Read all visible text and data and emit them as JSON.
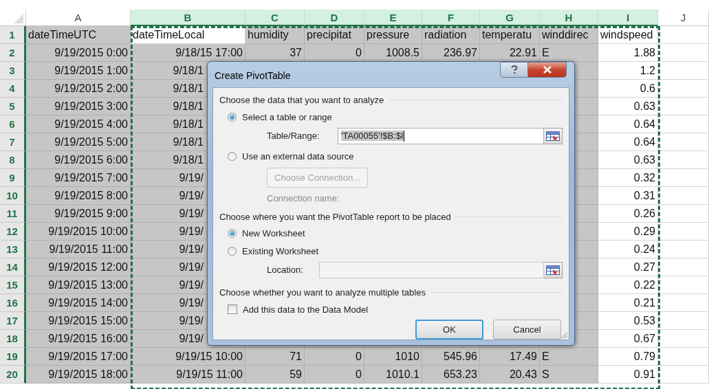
{
  "sheet": {
    "columns": [
      {
        "label": "A",
        "selected": false
      },
      {
        "label": "B",
        "selected": true
      },
      {
        "label": "C",
        "selected": true
      },
      {
        "label": "D",
        "selected": true
      },
      {
        "label": "E",
        "selected": true
      },
      {
        "label": "F",
        "selected": true
      },
      {
        "label": "G",
        "selected": true
      },
      {
        "label": "H",
        "selected": true
      },
      {
        "label": "I",
        "selected": true
      },
      {
        "label": "J",
        "selected": false
      }
    ],
    "rows": [
      {
        "label": "1",
        "cells": [
          "dateTimeUTC",
          "dateTimeLocal",
          "humidity",
          "precipitat",
          "pressure",
          "radiation",
          "temperatu",
          "winddirec",
          "windspeed"
        ]
      },
      {
        "label": "2",
        "cells": [
          "9/19/2015 0:00",
          "9/18/15 17:00",
          "37",
          "0",
          "1008.5",
          "236.97",
          "22.91",
          "E",
          "1.88"
        ]
      },
      {
        "label": "3",
        "cells": [
          "9/19/2015 1:00",
          "9/18/1",
          null,
          null,
          null,
          null,
          null,
          null,
          "1.2"
        ]
      },
      {
        "label": "4",
        "cells": [
          "9/19/2015 2:00",
          "9/18/1",
          null,
          null,
          null,
          null,
          null,
          null,
          "0.6"
        ]
      },
      {
        "label": "5",
        "cells": [
          "9/19/2015 3:00",
          "9/18/1",
          null,
          null,
          null,
          null,
          null,
          null,
          "0.63"
        ]
      },
      {
        "label": "6",
        "cells": [
          "9/19/2015 4:00",
          "9/18/1",
          null,
          null,
          null,
          null,
          null,
          null,
          "0.64"
        ]
      },
      {
        "label": "7",
        "cells": [
          "9/19/2015 5:00",
          "9/18/1",
          null,
          null,
          null,
          null,
          null,
          null,
          "0.64"
        ]
      },
      {
        "label": "8",
        "cells": [
          "9/19/2015 6:00",
          "9/18/1",
          null,
          null,
          null,
          null,
          null,
          null,
          "0.63"
        ]
      },
      {
        "label": "9",
        "cells": [
          "9/19/2015 7:00",
          "9/19/",
          null,
          null,
          null,
          null,
          null,
          null,
          "0.32"
        ]
      },
      {
        "label": "10",
        "cells": [
          "9/19/2015 8:00",
          "9/19/",
          null,
          null,
          null,
          null,
          null,
          null,
          "0.31"
        ]
      },
      {
        "label": "11",
        "cells": [
          "9/19/2015 9:00",
          "9/19/",
          null,
          null,
          null,
          null,
          null,
          null,
          "0.26"
        ]
      },
      {
        "label": "12",
        "cells": [
          "9/19/2015 10:00",
          "9/19/",
          null,
          null,
          null,
          null,
          null,
          null,
          "0.29"
        ]
      },
      {
        "label": "13",
        "cells": [
          "9/19/2015 11:00",
          "9/19/",
          null,
          null,
          null,
          null,
          null,
          null,
          "0.24"
        ]
      },
      {
        "label": "14",
        "cells": [
          "9/19/2015 12:00",
          "9/19/",
          null,
          null,
          null,
          null,
          null,
          null,
          "0.27"
        ]
      },
      {
        "label": "15",
        "cells": [
          "9/19/2015 13:00",
          "9/19/",
          null,
          null,
          null,
          null,
          null,
          null,
          "0.22"
        ]
      },
      {
        "label": "16",
        "cells": [
          "9/19/2015 14:00",
          "9/19/",
          null,
          null,
          null,
          null,
          null,
          null,
          "0.21"
        ]
      },
      {
        "label": "17",
        "cells": [
          "9/19/2015 15:00",
          "9/19/",
          null,
          null,
          null,
          null,
          null,
          null,
          "0.53"
        ]
      },
      {
        "label": "18",
        "cells": [
          "9/19/2015 16:00",
          "9/19/",
          null,
          null,
          null,
          null,
          null,
          null,
          "0.67"
        ]
      },
      {
        "label": "19",
        "cells": [
          "9/19/2015 17:00",
          "9/19/15 10:00",
          "71",
          "0",
          "1010",
          "545.96",
          "17.49",
          "E",
          "0.79"
        ]
      },
      {
        "label": "20",
        "cells": [
          "9/19/2015 18:00",
          "9/19/15 11:00",
          "59",
          "0",
          "1010.1",
          "653.23",
          "20.43",
          "S",
          "0.91"
        ]
      }
    ]
  },
  "dialog": {
    "title": "Create PivotTable",
    "data_section": {
      "heading": "Choose the data that you want to analyze",
      "options": [
        {
          "label": "Select a table or range",
          "selected": true
        },
        {
          "label": "Use an external data source",
          "selected": false
        }
      ],
      "table_range": {
        "label": "Table/Range:",
        "value": "'TA00055'!$B:$I",
        "text_selected": true
      },
      "connection_button": {
        "label": "Choose Connection...",
        "disabled": true
      },
      "connection_name": {
        "label": "Connection name:",
        "disabled": true
      }
    },
    "placement_section": {
      "heading": "Choose where you want the PivotTable report to be placed",
      "options": [
        {
          "label": "New Worksheet",
          "selected": true
        },
        {
          "label": "Existing Worksheet",
          "selected": false
        }
      ],
      "location": {
        "label": "Location:",
        "disabled": true
      }
    },
    "tables_section": {
      "heading": "Choose whether you want to analyze multiple tables",
      "checkbox": {
        "label": "Add this data to the Data Model",
        "checked": false
      }
    },
    "buttons": [
      {
        "label": "OK",
        "default": true
      },
      {
        "label": "Cancel",
        "default": false
      }
    ]
  }
}
